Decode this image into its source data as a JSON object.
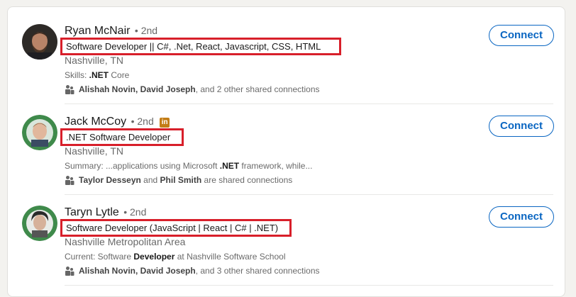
{
  "results": [
    {
      "name": "Ryan McNair",
      "degree": "• 2nd",
      "headline": "Software Developer || C#, .Net, React, Javascript, CSS, HTML",
      "location": "Nashville, TN",
      "detail_prefix": "Skills: ",
      "detail_bold": ".NET",
      "detail_suffix": " Core",
      "shared_a": "Alishah Novin, David Joseph",
      "shared_mid": ", and 2 other shared connections",
      "shared_b": "",
      "connect_label": "Connect"
    },
    {
      "name": "Jack McCoy",
      "degree": "• 2nd",
      "badge": "in",
      "headline": ".NET Software Developer",
      "location": "Nashville, TN",
      "detail_prefix": "Summary: ...applications using Microsoft ",
      "detail_bold": ".NET",
      "detail_suffix": " framework, while...",
      "shared_a": "Taylor Desseyn",
      "shared_mid": " and ",
      "shared_b": "Phil Smith",
      "shared_end": " are shared connections",
      "connect_label": "Connect"
    },
    {
      "name": "Taryn Lytle",
      "degree": "• 2nd",
      "headline": "Software Developer (JavaScript | React | C# | .NET)",
      "location": "Nashville Metropolitan Area",
      "detail_prefix": "Current: Software ",
      "detail_bold": "Developer",
      "detail_suffix": " at Nashville Software School",
      "shared_a": "Alishah Novin, David Joseph",
      "shared_mid": ", and 3 other shared connections",
      "shared_b": "",
      "connect_label": "Connect"
    }
  ],
  "colors": {
    "accent": "#0a66c2",
    "highlight_box": "#d81f2a",
    "badge": "#c37d16"
  }
}
